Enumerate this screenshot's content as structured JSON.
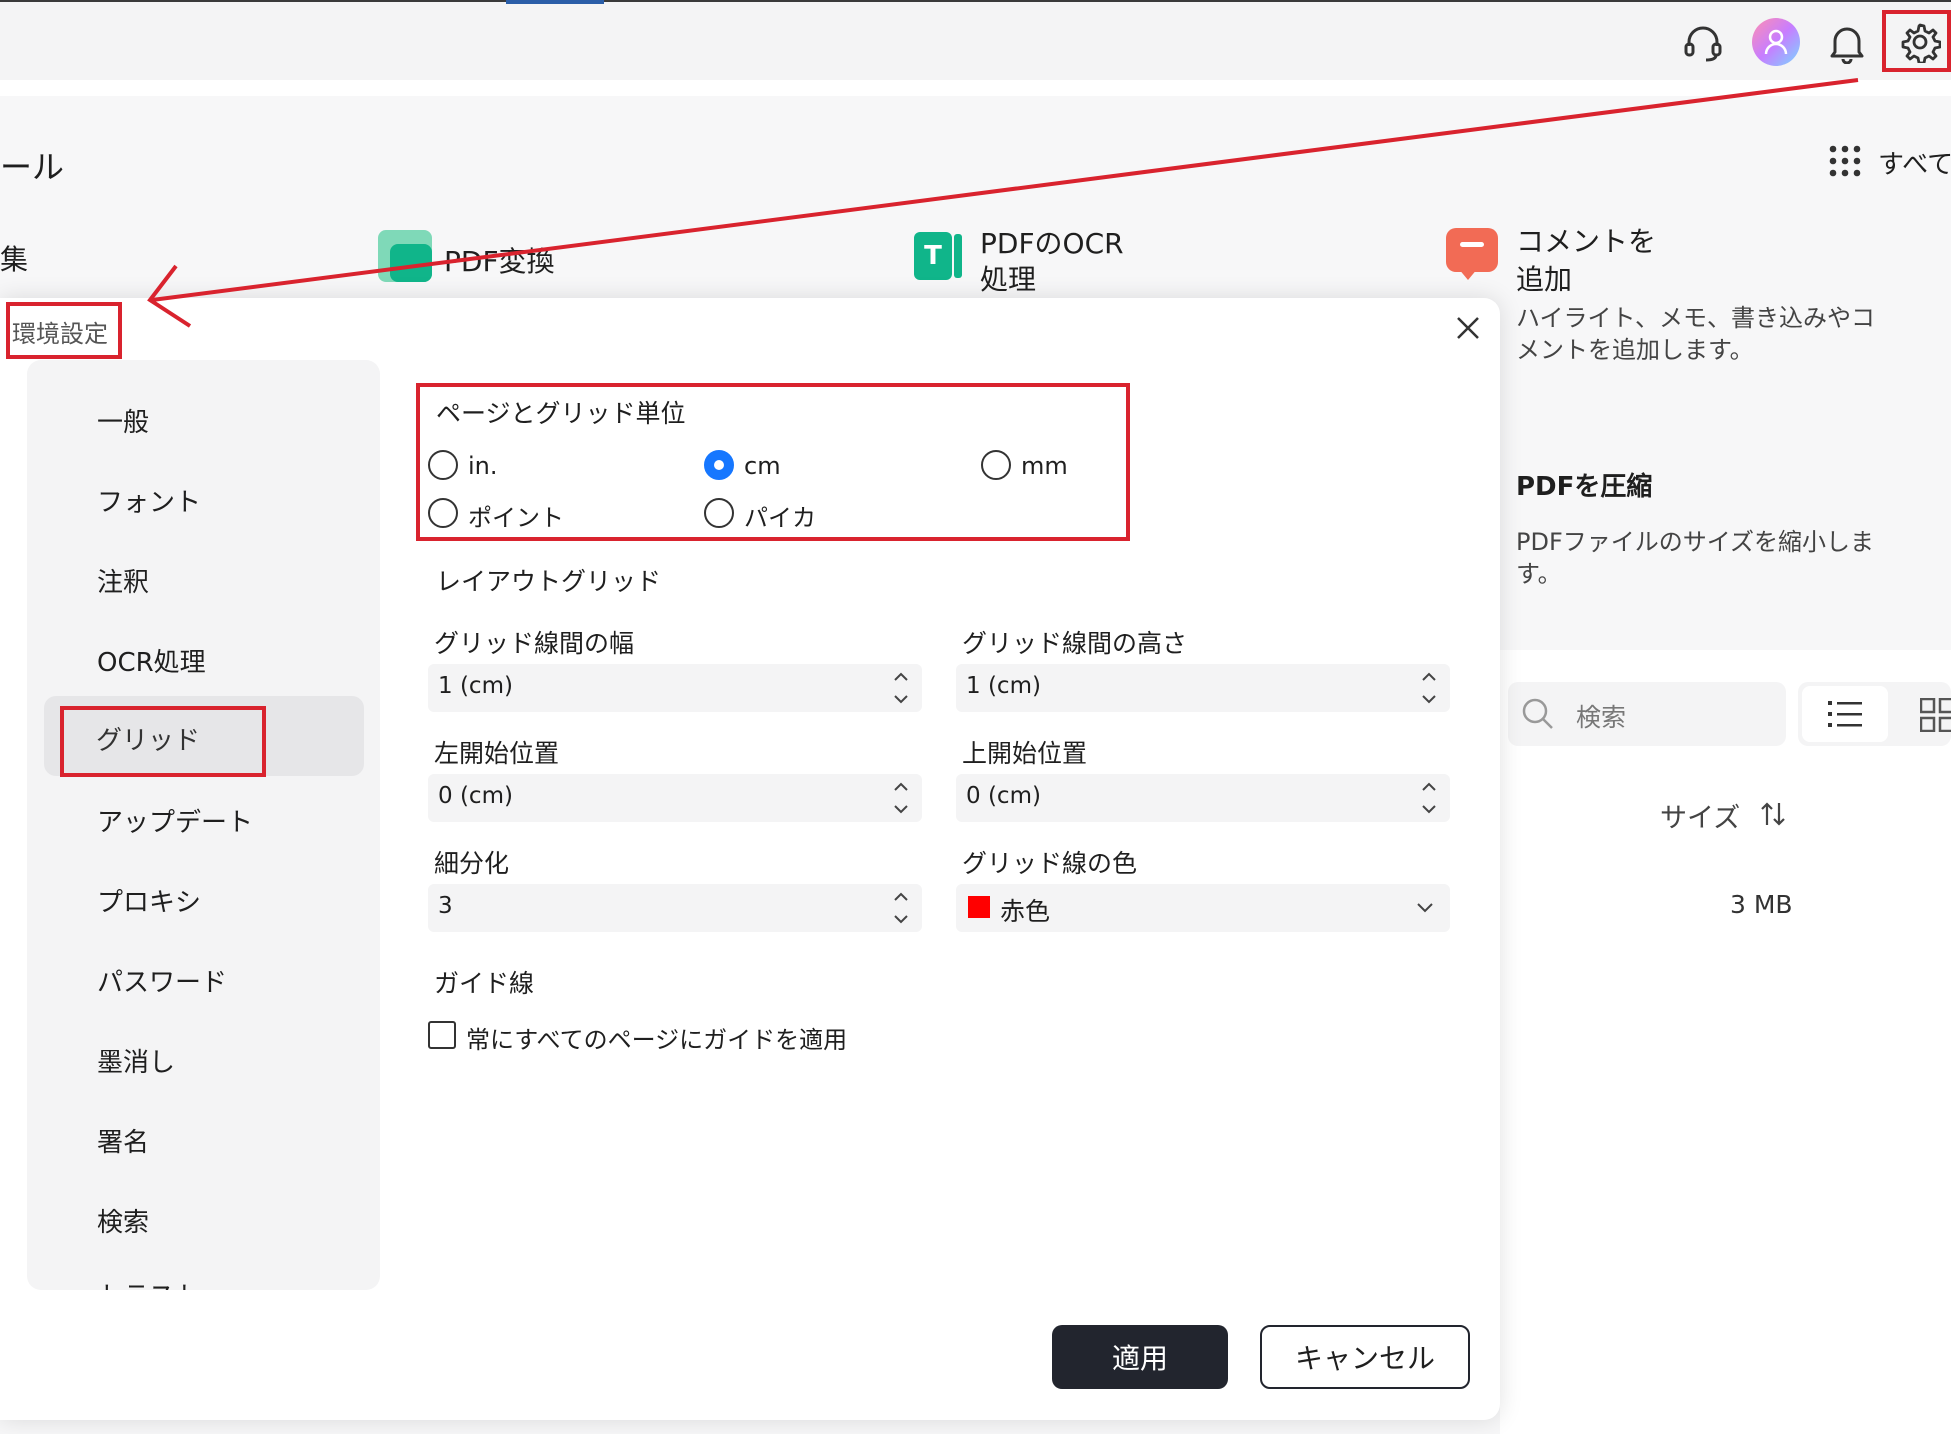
{
  "background": {
    "section_title": "ール",
    "all_tools_label": "すべて",
    "edit_fragment": "集",
    "tiles": [
      {
        "title": "PDF変換"
      },
      {
        "title_line1": "PDFのOCR",
        "title_line2": "処理"
      },
      {
        "title_line1": "コメントを",
        "title_line2": "追加",
        "desc_line1": "ハイライト、メモ、書き込みやコ",
        "desc_line2": "メントを追加します。"
      },
      {
        "title": "PDFを圧縮",
        "desc_line1": "PDFファイルのサイズを縮小しま",
        "desc_line2": "す。"
      }
    ],
    "search_placeholder": "検索",
    "size_header": "サイズ",
    "size_value": "3 MB"
  },
  "dialog": {
    "title": "環境設定",
    "sidebar": {
      "items": [
        {
          "label": "一般"
        },
        {
          "label": "フォント"
        },
        {
          "label": "注釈"
        },
        {
          "label": "OCR処理"
        },
        {
          "label": "グリッド",
          "active": true
        },
        {
          "label": "アップデート"
        },
        {
          "label": "プロキシ"
        },
        {
          "label": "パスワード"
        },
        {
          "label": "墨消し"
        },
        {
          "label": "署名"
        },
        {
          "label": "検索"
        },
        {
          "label": "トラスト"
        }
      ]
    },
    "units": {
      "title": "ページとグリッド単位",
      "options": [
        {
          "label": "in.",
          "selected": false
        },
        {
          "label": "cm",
          "selected": true
        },
        {
          "label": "mm",
          "selected": false
        },
        {
          "label": "ポイント",
          "selected": false
        },
        {
          "label": "パイカ",
          "selected": false
        }
      ]
    },
    "layout_grid": {
      "title": "レイアウトグリッド",
      "grid_width_label": "グリッド線間の幅",
      "grid_width_value": "1 (cm)",
      "grid_height_label": "グリッド線間の高さ",
      "grid_height_value": "1 (cm)",
      "left_start_label": "左開始位置",
      "left_start_value": "0 (cm)",
      "top_start_label": "上開始位置",
      "top_start_value": "0 (cm)",
      "subdivision_label": "細分化",
      "subdivision_value": "3",
      "grid_color_label": "グリッド線の色",
      "grid_color_value": "赤色",
      "grid_color_hex": "#ff0000"
    },
    "guides": {
      "title": "ガイド線",
      "apply_all_label": "常にすべてのページにガイドを適用",
      "apply_all_checked": false
    },
    "apply_label": "適用",
    "cancel_label": "キャンセル"
  },
  "colors": {
    "accent": "#1677ff",
    "annotation_red": "#d9232e",
    "primary_button": "#22252e"
  }
}
